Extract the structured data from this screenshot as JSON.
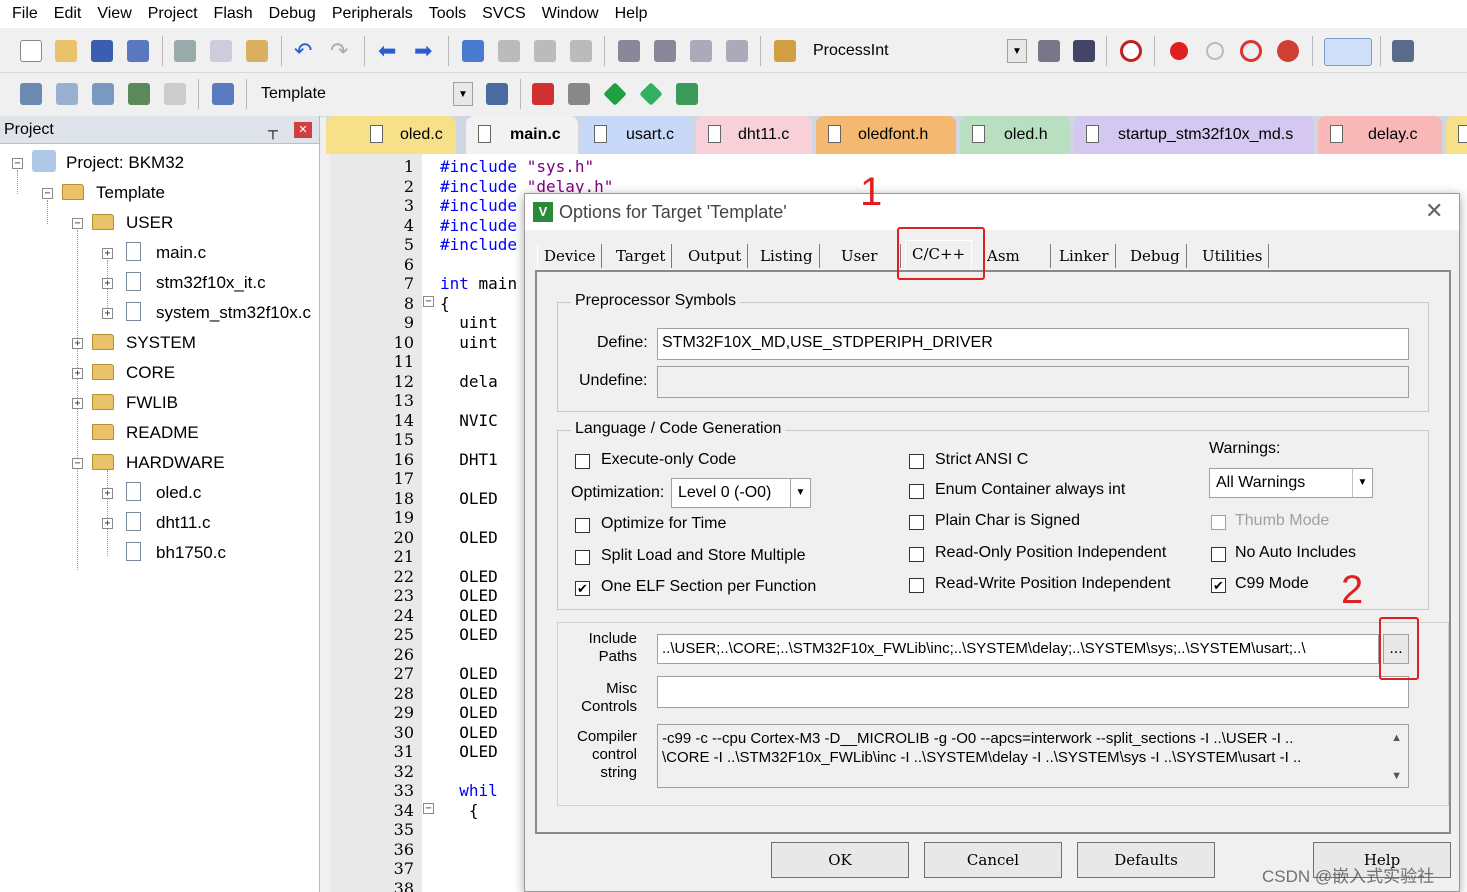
{
  "menu": [
    "File",
    "Edit",
    "View",
    "Project",
    "Flash",
    "Debug",
    "Peripherals",
    "Tools",
    "SVCS",
    "Window",
    "Help"
  ],
  "toolbar1": {
    "process_combo": "ProcessInt"
  },
  "toolbar2": {
    "target_combo": "Template"
  },
  "project_panel": {
    "title": "Project",
    "pin": "⮇",
    "close": "✕",
    "tree": {
      "project": "Project: BKM32",
      "target": "Template",
      "user": "USER",
      "user_files": [
        "main.c",
        "stm32f10x_it.c",
        "system_stm32f10x.c"
      ],
      "groups": [
        "SYSTEM",
        "CORE",
        "FWLIB",
        "README",
        "HARDWARE"
      ],
      "hardware_files": [
        "oled.c",
        "dht11.c",
        "bh1750.c"
      ]
    }
  },
  "tabs": [
    "oled.c",
    "main.c",
    "usart.c",
    "dht11.c",
    "oledfont.h",
    "oled.h",
    "startup_stm32f10x_md.s",
    "delay.c"
  ],
  "editor": {
    "line_numbers": [
      "1",
      "2",
      "3",
      "4",
      "5",
      "6",
      "7",
      "8",
      "9",
      "10",
      "11",
      "12",
      "13",
      "14",
      "15",
      "16",
      "17",
      "18",
      "19",
      "20",
      "21",
      "22",
      "23",
      "24",
      "25",
      "26",
      "27",
      "28",
      "29",
      "30",
      "31",
      "32",
      "33",
      "34",
      "35",
      "36",
      "37",
      "38"
    ],
    "lines": [
      {
        "n": 0,
        "kw": "#include ",
        "str": "\"sys.h\"",
        "txt": ""
      },
      {
        "n": 1,
        "kw": "#include ",
        "str": "\"delay.h\"",
        "txt": ""
      },
      {
        "n": 2,
        "kw": "#include",
        "str": "",
        "txt": ""
      },
      {
        "n": 3,
        "kw": "#include",
        "str": "",
        "txt": ""
      },
      {
        "n": 4,
        "kw": "#include",
        "str": "",
        "txt": ""
      },
      {
        "n": 6,
        "kw": "int",
        "str": "",
        "txt": " main"
      },
      {
        "n": 7,
        "kw": "",
        "str": "",
        "txt": "{"
      },
      {
        "n": 8,
        "kw": "",
        "str": "",
        "txt": "  uint"
      },
      {
        "n": 9,
        "kw": "",
        "str": "",
        "txt": "  uint"
      },
      {
        "n": 11,
        "kw": "",
        "str": "",
        "txt": "  dela"
      },
      {
        "n": 13,
        "kw": "",
        "str": "",
        "txt": "  NVIC"
      },
      {
        "n": 15,
        "kw": "",
        "str": "",
        "txt": "  DHT1"
      },
      {
        "n": 17,
        "kw": "",
        "str": "",
        "txt": "  OLED"
      },
      {
        "n": 19,
        "kw": "",
        "str": "",
        "txt": "  OLED"
      },
      {
        "n": 21,
        "kw": "",
        "str": "",
        "txt": "  OLED"
      },
      {
        "n": 22,
        "kw": "",
        "str": "",
        "txt": "  OLED"
      },
      {
        "n": 23,
        "kw": "",
        "str": "",
        "txt": "  OLED"
      },
      {
        "n": 24,
        "kw": "",
        "str": "",
        "txt": "  OLED"
      },
      {
        "n": 26,
        "kw": "",
        "str": "",
        "txt": "  OLED"
      },
      {
        "n": 27,
        "kw": "",
        "str": "",
        "txt": "  OLED"
      },
      {
        "n": 28,
        "kw": "",
        "str": "",
        "txt": "  OLED"
      },
      {
        "n": 29,
        "kw": "",
        "str": "",
        "txt": "  OLED"
      },
      {
        "n": 30,
        "kw": "",
        "str": "",
        "txt": "  OLED"
      },
      {
        "n": 32,
        "kw": "  whil",
        "str": "",
        "txt": ""
      },
      {
        "n": 33,
        "kw": "",
        "str": "",
        "txt": "   {"
      }
    ]
  },
  "dialog": {
    "title": "Options for Target 'Template'",
    "close": "✕",
    "tabs": [
      "Device",
      "Target",
      "Output",
      "Listing",
      "User",
      "C/C++",
      "Asm",
      "Linker",
      "Debug",
      "Utilities"
    ],
    "preprocessor": {
      "title": "Preprocessor Symbols",
      "define_label": "Define:",
      "define_value": "STM32F10X_MD,USE_STDPERIPH_DRIVER",
      "undefine_label": "Undefine:",
      "undefine_value": ""
    },
    "language": {
      "title": "Language / Code Generation",
      "execute_only": "Execute-only Code",
      "optimization_label": "Optimization:",
      "optimization_value": "Level 0 (-O0)",
      "optimize_time": "Optimize for Time",
      "split_load": "Split Load and Store Multiple",
      "one_elf": "One ELF Section per Function",
      "strict_ansi": "Strict ANSI C",
      "enum_container": "Enum Container always int",
      "plain_char": "Plain Char is Signed",
      "ro_pos": "Read-Only Position Independent",
      "rw_pos": "Read-Write Position Independent",
      "warnings_label": "Warnings:",
      "warnings_value": "All Warnings",
      "thumb_mode": "Thumb Mode",
      "no_auto": "No Auto Includes",
      "c99": "C99 Mode",
      "check": "✔"
    },
    "include_label_1": "Include",
    "include_label_2": "Paths",
    "include_value": "..\\USER;..\\CORE;..\\STM32F10x_FWLib\\inc;..\\SYSTEM\\delay;..\\SYSTEM\\sys;..\\SYSTEM\\usart;..\\",
    "browse": "...",
    "misc_label_1": "Misc",
    "misc_label_2": "Controls",
    "misc_value": "",
    "compiler_label_1": "Compiler",
    "compiler_label_2": "control",
    "compiler_label_3": "string",
    "compiler_line1": "-c99 -c --cpu Cortex-M3 -D__MICROLIB -g -O0 --apcs=interwork --split_sections -I ..\\USER -I ..",
    "compiler_line2": "\\CORE -I ..\\STM32F10x_FWLib\\inc -I ..\\SYSTEM\\delay -I ..\\SYSTEM\\sys -I ..\\SYSTEM\\usart -I ..",
    "buttons": {
      "ok": "OK",
      "cancel": "Cancel",
      "defaults": "Defaults",
      "help": "Help"
    }
  },
  "annotations": {
    "one": "1",
    "two": "2"
  },
  "watermark": "CSDN @嵌入式实验社",
  "colors": {
    "annotation": "#e02020",
    "keyword": "#0000ff",
    "string": "#800080",
    "dialog_bg": "#f0f0f0"
  }
}
